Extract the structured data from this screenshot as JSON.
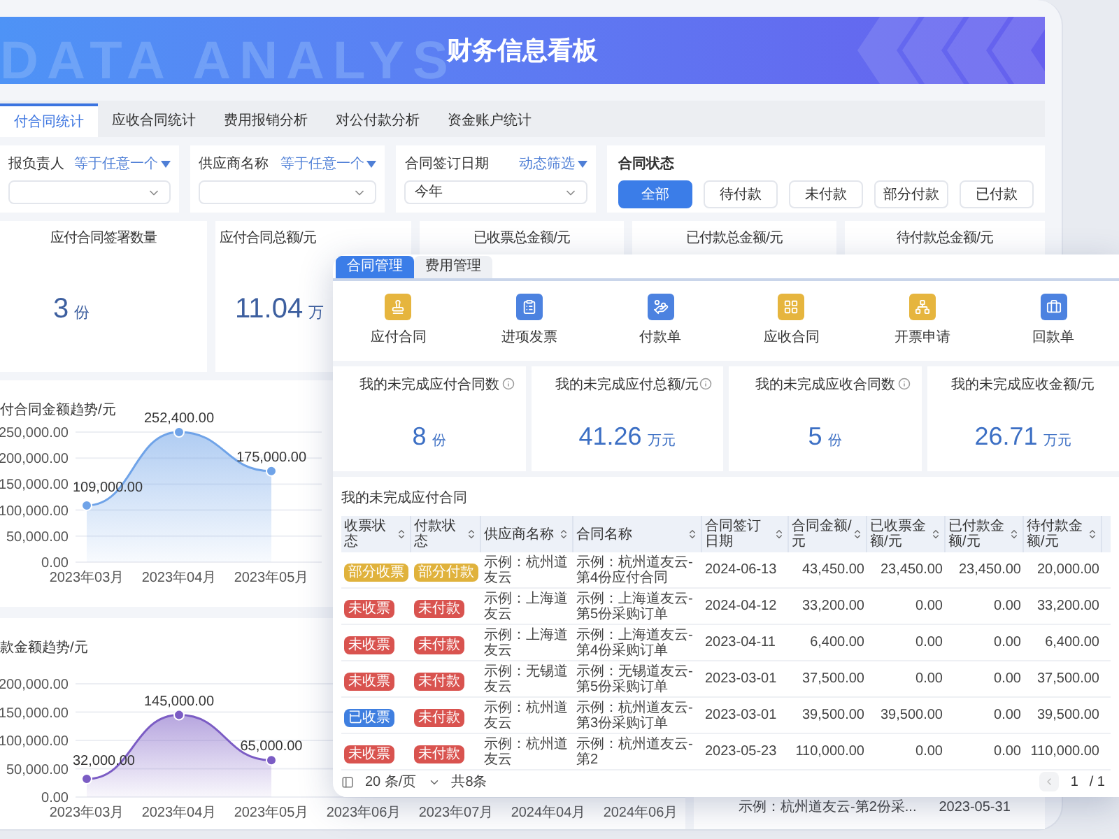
{
  "banner": {
    "backdrop_text": "DATA ANALYS",
    "title": "财务信息看板"
  },
  "tabs": [
    {
      "label": "付合同统计",
      "selected": true
    },
    {
      "label": "应收合同统计",
      "selected": false
    },
    {
      "label": "费用报销分析",
      "selected": false
    },
    {
      "label": "对公付款分析",
      "selected": false
    },
    {
      "label": "资金账户统计",
      "selected": false
    }
  ],
  "filters": [
    {
      "kind": "select",
      "label": "报负责人",
      "operator": "等于任意一个"
    },
    {
      "kind": "select",
      "label": "供应商名称",
      "operator": "等于任意一个"
    },
    {
      "kind": "select",
      "label": "合同签订日期",
      "operator": "动态筛选",
      "value": "今年"
    },
    {
      "kind": "buttons",
      "label": "合同状态",
      "options": [
        {
          "label": "全部",
          "selected": true
        },
        {
          "label": "待付款",
          "selected": false
        },
        {
          "label": "未付款",
          "selected": false
        },
        {
          "label": "部分付款",
          "selected": false
        },
        {
          "label": "已付款",
          "selected": false
        }
      ]
    }
  ],
  "kpis": [
    {
      "title": "应付合同签署数量",
      "value": "3",
      "unit": "份"
    },
    {
      "title": "应付合同总额/元",
      "value": "11.04",
      "unit": "万"
    },
    {
      "title": "已收票总金额/元"
    },
    {
      "title": "已付款总金额/元"
    },
    {
      "title": "待付款总金额/元"
    }
  ],
  "charts": [
    {
      "title": "付合同金额趋势/元",
      "chart_data": {
        "type": "area",
        "categories": [
          "2023年03月",
          "2023年04月",
          "2023年05月"
        ],
        "series": [
          {
            "color": "#6fa3e8",
            "values": [
              109000,
              250000,
              175000
            ]
          }
        ],
        "ylim": [
          0,
          250000
        ],
        "yticks": [
          {
            "value": 0,
            "label": "0.00"
          },
          {
            "value": 50000,
            "label": "50,000.00"
          },
          {
            "value": 100000,
            "label": "100,000.00"
          },
          {
            "value": 150000,
            "label": "150,000.00"
          },
          {
            "value": 200000,
            "label": "200,000.00"
          },
          {
            "value": 250000,
            "label": "250,000.00"
          }
        ],
        "grid": true,
        "value_labels": [
          "109,000.00",
          "252,400.00",
          "175,000.00"
        ]
      }
    },
    {
      "title": "款金额趋势/元",
      "chart_data": {
        "type": "area",
        "categories": [
          "2023年03月",
          "2023年04月",
          "2023年05月",
          "2023年06月",
          "2023年07月",
          "2024年04月",
          "2024年06月"
        ],
        "series": [
          {
            "color": "#7b5cc4",
            "values": [
              32000,
              145000,
              65000,
              null,
              null,
              null,
              null
            ]
          }
        ],
        "ylim": [
          0,
          200000
        ],
        "yticks": [
          {
            "value": 0,
            "label": "0.00"
          },
          {
            "value": 50000,
            "label": "50,000.00"
          },
          {
            "value": 100000,
            "label": "100,000.00"
          },
          {
            "value": 150000,
            "label": "150,000.00"
          },
          {
            "value": 200000,
            "label": "200,000.00"
          }
        ],
        "grid": true,
        "value_labels": [
          "32,000.00",
          "145,000.00",
          "65,000.00",
          null,
          null,
          null,
          null
        ]
      }
    }
  ],
  "contract_table": {
    "rows": [
      {
        "cells": [
          "示例：杭州道友云-第2份采...",
          "2023-05-31"
        ]
      }
    ]
  },
  "overlay": {
    "tabs": [
      {
        "label": "合同管理",
        "selected": true
      },
      {
        "label": "费用管理",
        "selected": false
      }
    ],
    "shortcuts": [
      {
        "label": "应付合同",
        "color": "#e6b53e"
      },
      {
        "label": "进项发票",
        "color": "#4c82e0"
      },
      {
        "label": "付款单",
        "color": "#4c82e0"
      },
      {
        "label": "应收合同",
        "color": "#e6b53e"
      },
      {
        "label": "开票申请",
        "color": "#e6b53e"
      },
      {
        "label": "回款单",
        "color": "#4c82e0"
      }
    ],
    "stats": [
      {
        "title": "我的未完成应付合同数",
        "info": true,
        "value": "8",
        "unit": "份"
      },
      {
        "title": "我的未完成应付总额/元",
        "info": true,
        "value": "41.26",
        "unit": "万元"
      },
      {
        "title": "我的未完成应收合同数",
        "info": true,
        "value": "5",
        "unit": "份"
      },
      {
        "title": "我的未完成应收金额/元",
        "info": false,
        "value": "26.71",
        "unit": "万元"
      }
    ],
    "table": {
      "title": "我的未完成应付合同",
      "columns": [
        "收票状态",
        "付款状态",
        "供应商名称",
        "合同名称",
        "合同签订日期",
        "合同金额/元",
        "已收票金额/元",
        "已付款金额/元",
        "待付款金额/元"
      ],
      "rows": [
        {
          "cells": [
            {
              "text": "部分收票",
              "color": "#e0b23c"
            },
            {
              "text": "部分付款",
              "color": "#e0b23c"
            },
            "示例：杭州道友云",
            "示例：杭州道友云-第4份应付合同",
            "2024-06-13",
            "43,450.00",
            "23,450.00",
            "23,450.00",
            "20,000.00"
          ]
        },
        {
          "cells": [
            {
              "text": "未收票",
              "color": "#d9534f"
            },
            {
              "text": "未付款",
              "color": "#d9534f"
            },
            "示例：上海道友云",
            "示例：上海道友云-第5份采购订单",
            "2024-04-12",
            "33,200.00",
            "0.00",
            "0.00",
            "33,200.00"
          ]
        },
        {
          "cells": [
            {
              "text": "未收票",
              "color": "#d9534f"
            },
            {
              "text": "未付款",
              "color": "#d9534f"
            },
            "示例：上海道友云",
            "示例：上海道友云-第4份采购订单",
            "2023-04-11",
            "6,400.00",
            "0.00",
            "0.00",
            "6,400.00"
          ]
        },
        {
          "cells": [
            {
              "text": "未收票",
              "color": "#d9534f"
            },
            {
              "text": "未付款",
              "color": "#d9534f"
            },
            "示例：无锡道友云",
            "示例：无锡道友云-第5份采购订单",
            "2023-03-01",
            "37,500.00",
            "0.00",
            "0.00",
            "37,500.00"
          ]
        },
        {
          "cells": [
            {
              "text": "已收票",
              "color": "#3f7fe0"
            },
            {
              "text": "未付款",
              "color": "#d9534f"
            },
            "示例：杭州道友云",
            "示例：杭州道友云-第3份采购订单",
            "2023-03-01",
            "39,500.00",
            "39,500.00",
            "0.00",
            "39,500.00"
          ]
        },
        {
          "cells": [
            {
              "text": "未收票",
              "color": "#d9534f"
            },
            {
              "text": "未付款",
              "color": "#d9534f"
            },
            "示例：杭州道友云",
            "示例：杭州道友云-第2",
            "2023-05-23",
            "110,000.00",
            "0.00",
            "0.00",
            "110,000.00"
          ]
        }
      ],
      "page_size": "20 条/页",
      "total": "共8条",
      "page": "1",
      "pages": "/ 1"
    }
  }
}
